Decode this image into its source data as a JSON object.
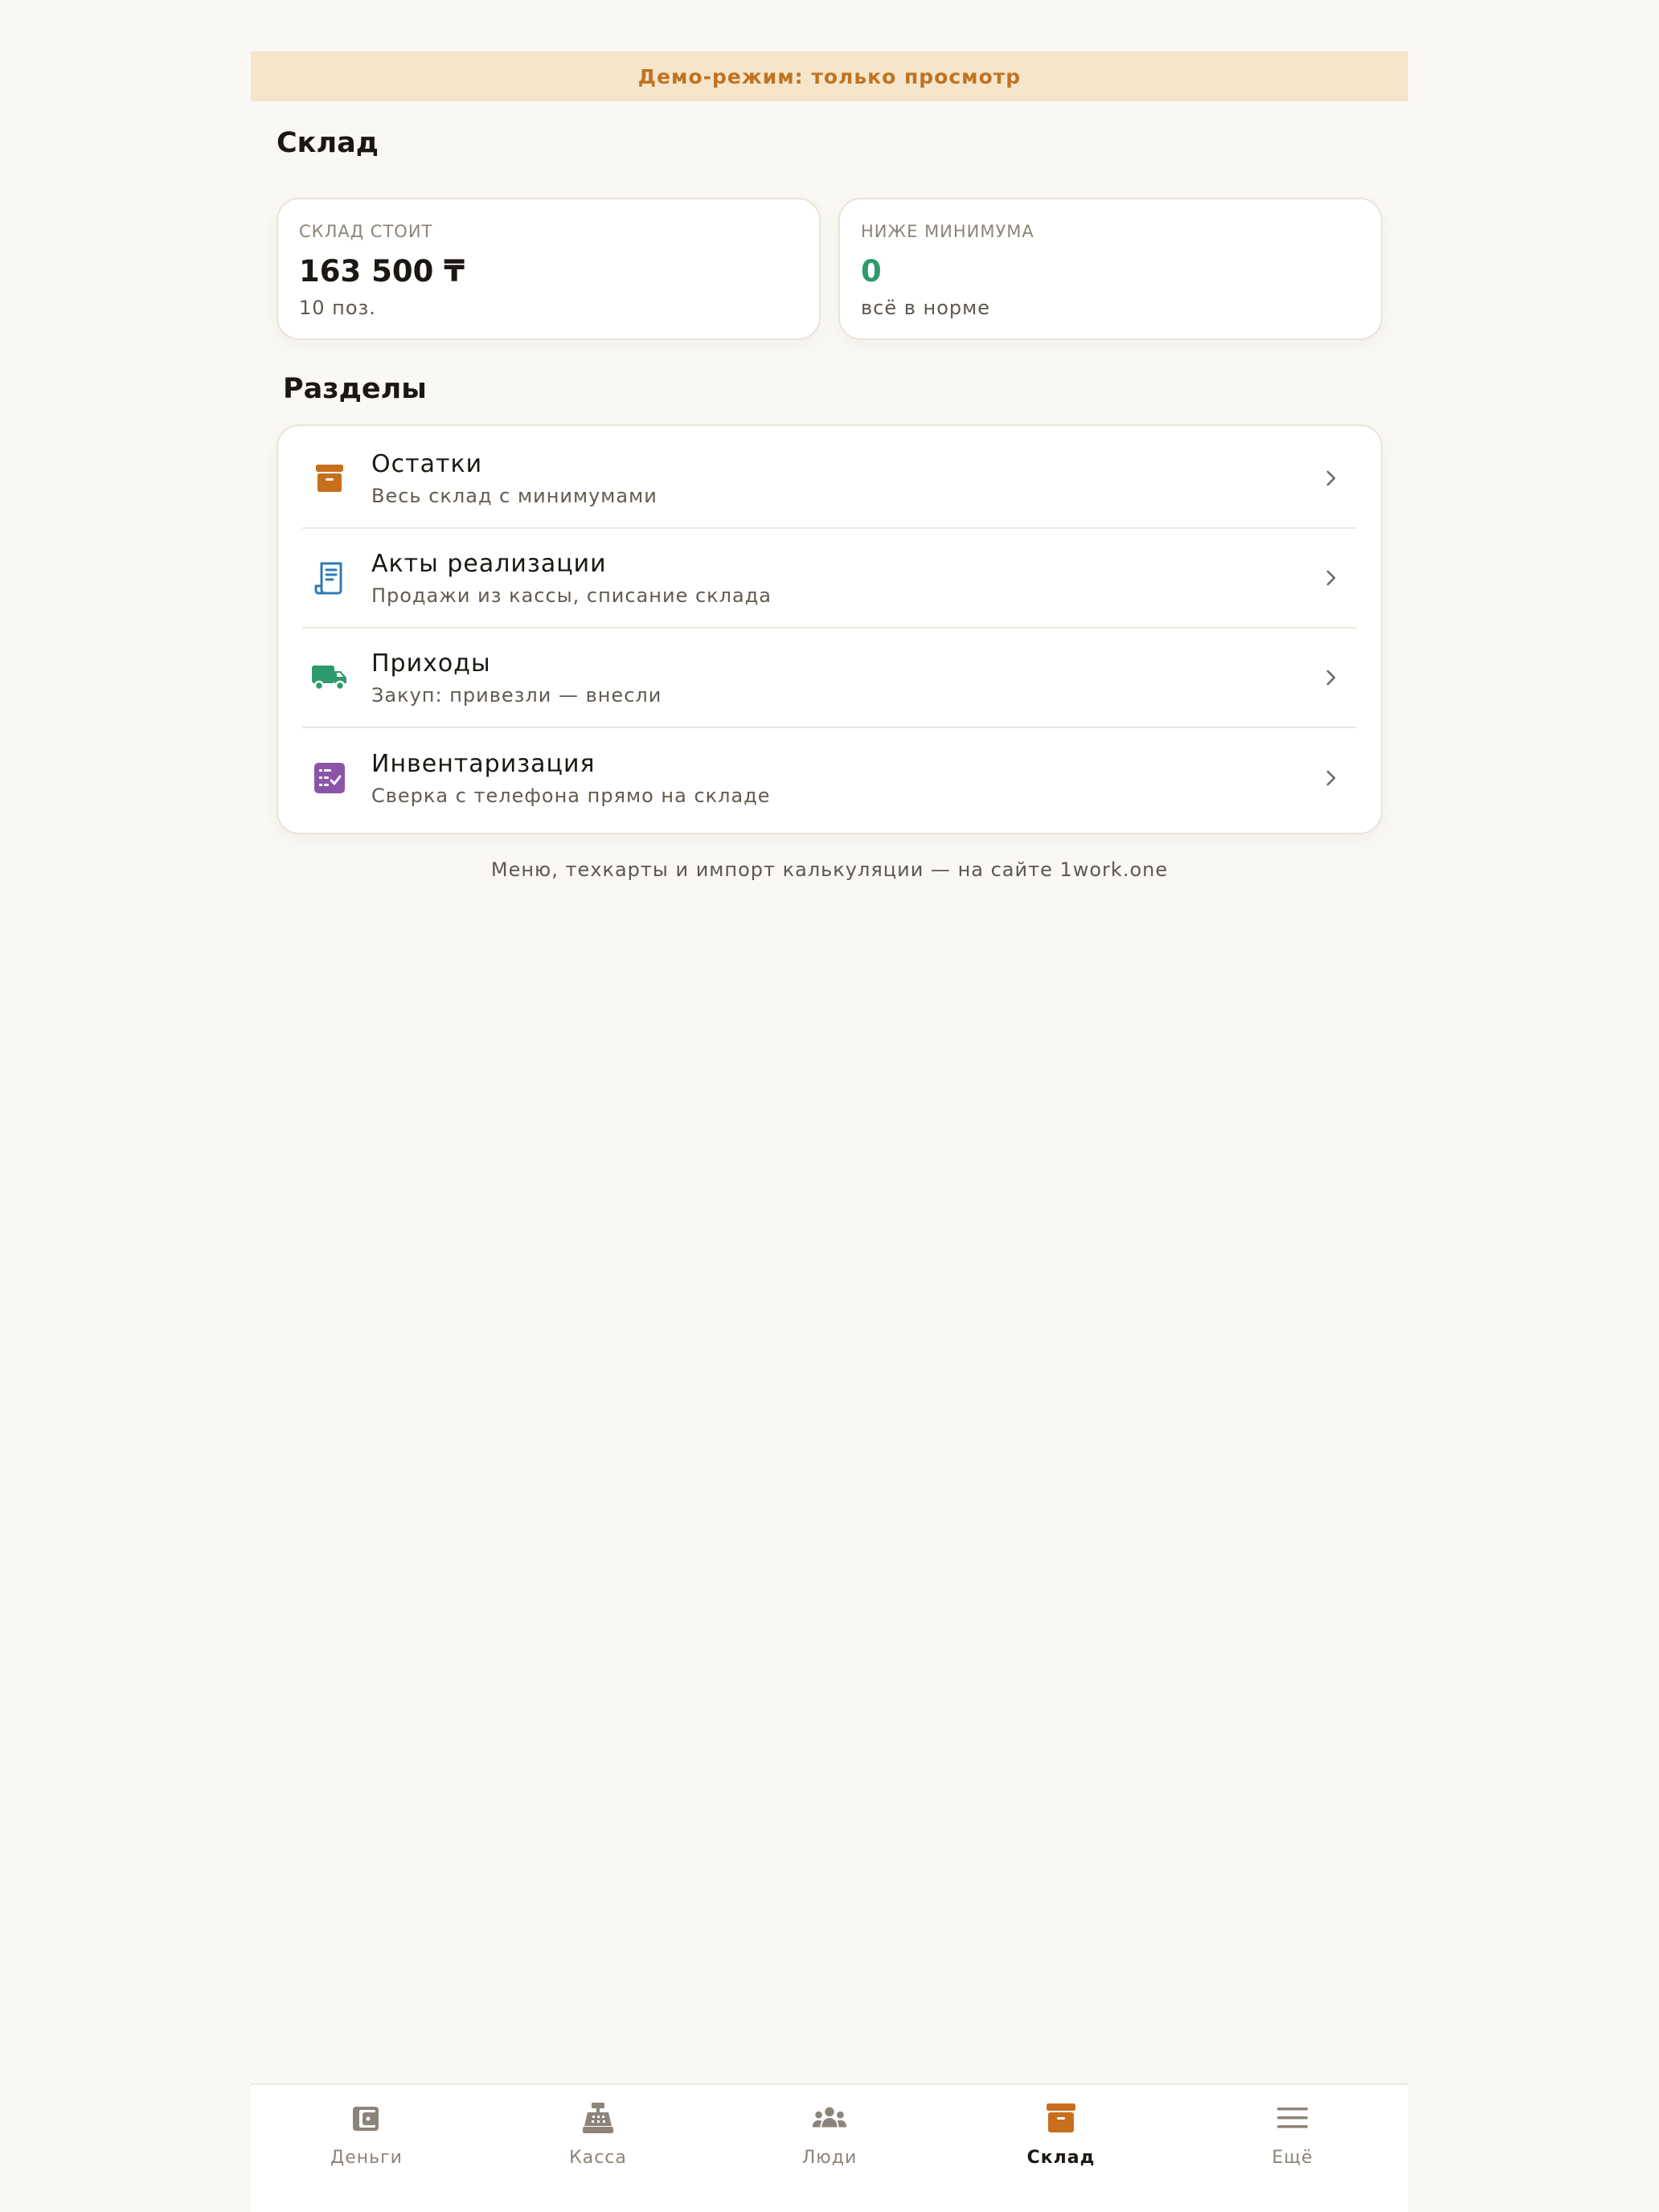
{
  "banner": {
    "text": "Демо-режим: только просмотр"
  },
  "page": {
    "title": "Склад"
  },
  "stats": [
    {
      "label": "СКЛАД СТОИТ",
      "value": "163 500 ₸",
      "sub": "10 поз."
    },
    {
      "label": "НИЖЕ МИНИМУМА",
      "value": "0",
      "sub": "всё в норме",
      "value_color": "#2f9a6b"
    }
  ],
  "sections": {
    "title": "Разделы",
    "items": [
      {
        "title": "Остатки",
        "subtitle": "Весь склад с минимумами",
        "icon": "archive-box-icon",
        "color": "#c86f1c"
      },
      {
        "title": "Акты реализации",
        "subtitle": "Продажи из кассы, списание склада",
        "icon": "receipt-icon",
        "color": "#2c7bb6"
      },
      {
        "title": "Приходы",
        "subtitle": "Закуп: привезли — внесли",
        "icon": "truck-icon",
        "color": "#2f9a6b"
      },
      {
        "title": "Инвентаризация",
        "subtitle": "Сверка с телефона прямо на складе",
        "icon": "checklist-icon",
        "color": "#8a55a8"
      }
    ]
  },
  "footer": {
    "note": "Меню, техкарты и импорт калькуляции — на сайте 1work.one"
  },
  "tabbar": {
    "tabs": [
      {
        "label": "Деньги",
        "icon": "wallet-icon",
        "active": false
      },
      {
        "label": "Касса",
        "icon": "cash-register-icon",
        "active": false
      },
      {
        "label": "Люди",
        "icon": "people-icon",
        "active": false
      },
      {
        "label": "Склад",
        "icon": "archive-box-icon",
        "active": true
      },
      {
        "label": "Ещё",
        "icon": "menu-icon",
        "active": false
      }
    ],
    "inactive_color": "#8c847a",
    "active_color": "#c86f1c"
  }
}
